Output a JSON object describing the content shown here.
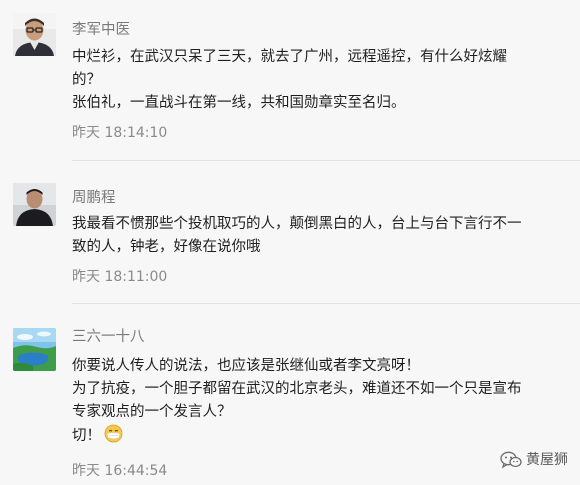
{
  "comments": [
    {
      "name": "李军中医",
      "lines": [
        "中烂衫，在武汉只呆了三天，就去了广州，远程遥控，有什么好炫耀",
        "的？",
        "张伯礼，一直战斗在第一线，共和国勋章实至名归。"
      ],
      "time": "昨天 18:14:10",
      "avatar": "avatar-man-glasses"
    },
    {
      "name": "周鹏程",
      "lines": [
        "我最看不惯那些个投机取巧的人，颠倒黑白的人，台上与台下言行不一",
        "致的人，钟老，好像在说你哦"
      ],
      "time": "昨天 18:11:00",
      "avatar": "avatar-man-dark-shirt"
    },
    {
      "name": "三六一十八",
      "lines": [
        "你要说人传人的说法，也应该是张继仙或者李文亮呀！",
        "为了抗疫，一个胆子都留在武汉的北京老头，难道还不如一个只是宣布",
        "专家观点的一个发言人？",
        "切！"
      ],
      "time": "昨天 16:44:54",
      "avatar": "avatar-landscape-lake",
      "emoji": "mask-face-emoji"
    }
  ],
  "watermark": {
    "text": "黄屋狮",
    "icon": "wechat-icon"
  },
  "colors": {
    "background": "#f7f7f7",
    "name": "#7a7a7a",
    "time": "#8a8a8a",
    "text": "#1f1f1f",
    "divider": "#e3e3e3"
  }
}
